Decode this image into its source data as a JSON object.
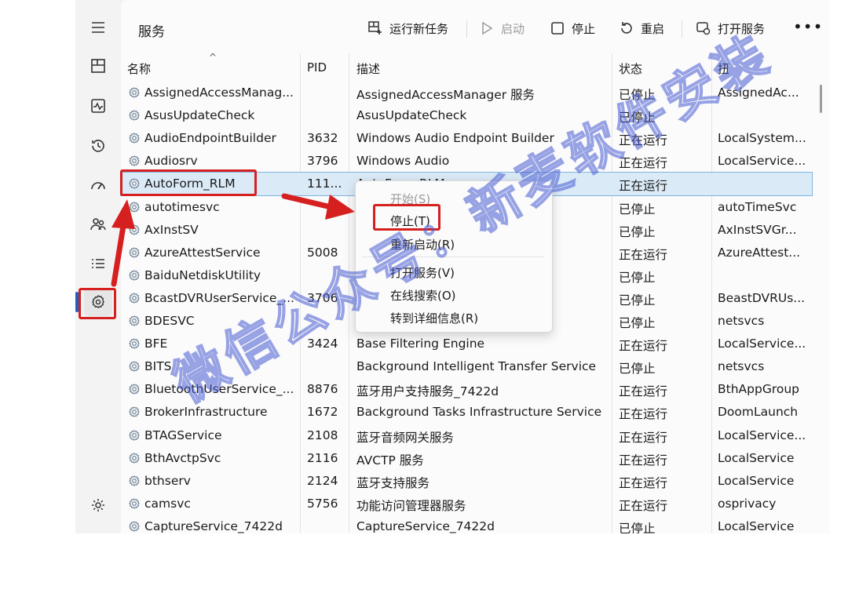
{
  "header": {
    "title": "服务",
    "run_task": "运行新任务",
    "start": "启动",
    "stop": "停止",
    "restart": "重启",
    "open_services": "打开服务",
    "more": "•••"
  },
  "columns": {
    "name": "名称",
    "pid": "PID",
    "desc": "描述",
    "status": "状态",
    "group": "扭"
  },
  "rows": [
    {
      "name": "AssignedAccessManag...",
      "pid": "",
      "desc": "AssignedAccessManager 服务",
      "status": "已停止",
      "group": "AssignedAc..."
    },
    {
      "name": "AsusUpdateCheck",
      "pid": "",
      "desc": "AsusUpdateCheck",
      "status": "已停止",
      "group": ""
    },
    {
      "name": "AudioEndpointBuilder",
      "pid": "3632",
      "desc": "Windows Audio Endpoint Builder",
      "status": "正在运行",
      "group": "LocalSystem..."
    },
    {
      "name": "Audiosrv",
      "pid": "3796",
      "desc": "Windows Audio",
      "status": "正在运行",
      "group": "LocalService..."
    },
    {
      "name": "AutoForm_RLM",
      "pid": "111...",
      "desc": "AutoForm RLM",
      "status": "正在运行",
      "group": ""
    },
    {
      "name": "autotimesvc",
      "pid": "",
      "desc": "",
      "status": "已停止",
      "group": "autoTimeSvc"
    },
    {
      "name": "AxInstSV",
      "pid": "",
      "desc": "",
      "status": "已停止",
      "group": "AxInstSVGr..."
    },
    {
      "name": "AzureAttestService",
      "pid": "5008",
      "desc": "",
      "status": "正在运行",
      "group": "AzureAttest..."
    },
    {
      "name": "BaiduNetdiskUtility",
      "pid": "",
      "desc": "",
      "status": "已停止",
      "group": ""
    },
    {
      "name": "BcastDVRUserService_...",
      "pid": "3706",
      "desc": "d",
      "status": "已停止",
      "group": "BeastDVRUs..."
    },
    {
      "name": "BDESVC",
      "pid": "",
      "desc": "ce",
      "status": "已停止",
      "group": "netsvcs"
    },
    {
      "name": "BFE",
      "pid": "3424",
      "desc": "Base Filtering Engine",
      "status": "正在运行",
      "group": "LocalService..."
    },
    {
      "name": "BITS",
      "pid": "",
      "desc": "Background Intelligent Transfer Service",
      "status": "已停止",
      "group": "netsvcs"
    },
    {
      "name": "BluetoothUserService_...",
      "pid": "8876",
      "desc": "蓝牙用户支持服务_7422d",
      "status": "正在运行",
      "group": "BthAppGroup"
    },
    {
      "name": "BrokerInfrastructure",
      "pid": "1672",
      "desc": "Background Tasks Infrastructure Service",
      "status": "正在运行",
      "group": "DoomLaunch"
    },
    {
      "name": "BTAGService",
      "pid": "2108",
      "desc": "蓝牙音频网关服务",
      "status": "正在运行",
      "group": "LocalService..."
    },
    {
      "name": "BthAvctpSvc",
      "pid": "2116",
      "desc": "AVCTP 服务",
      "status": "正在运行",
      "group": "LocalService"
    },
    {
      "name": "bthserv",
      "pid": "2124",
      "desc": "蓝牙支持服务",
      "status": "正在运行",
      "group": "LocalService"
    },
    {
      "name": "camsvc",
      "pid": "5756",
      "desc": "功能访问管理器服务",
      "status": "正在运行",
      "group": "osprivacy"
    },
    {
      "name": "CaptureService_7422d",
      "pid": "",
      "desc": "CaptureService_7422d",
      "status": "已停止",
      "group": "LocalService"
    }
  ],
  "context_menu": {
    "start": "开始(S)",
    "stop": "停止(T)",
    "restart": "重新启动(R)",
    "open_services": "打开服务(V)",
    "search_online": "在线搜索(O)",
    "go_to_details": "转到详细信息(R)"
  },
  "watermark": "微信公众号：新麦软件安装",
  "colors": {
    "highlight": "#d62020",
    "selection": "#dbeaf7",
    "accent": "#1f5fbf"
  }
}
